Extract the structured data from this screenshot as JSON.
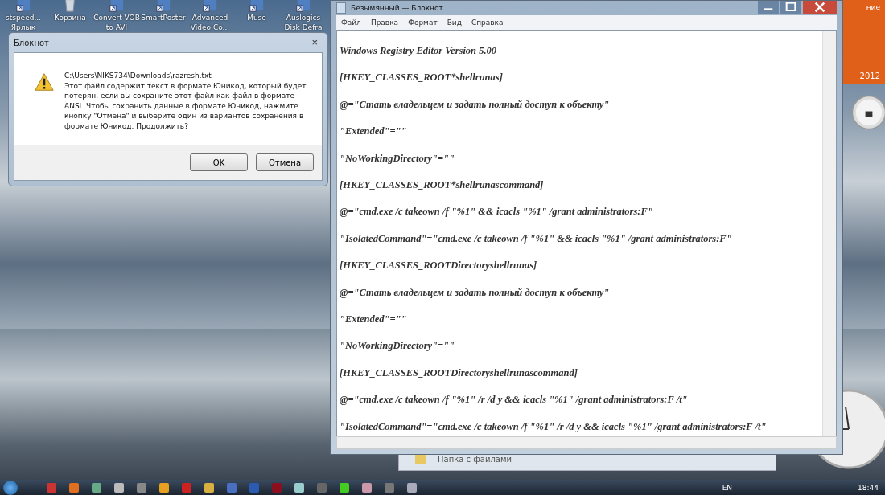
{
  "desktop_icons": [
    {
      "kind": "shortcut",
      "label": "stspeed...\nЯрлык"
    },
    {
      "kind": "trash",
      "label": "Корзина"
    },
    {
      "kind": "shortcut",
      "label": "Convert VOB\nto AVI"
    },
    {
      "kind": "shortcut",
      "label": "SmartPoster"
    },
    {
      "kind": "shortcut",
      "label": "Advanced\nVideo Co..."
    },
    {
      "kind": "shortcut",
      "label": "Muse"
    },
    {
      "kind": "shortcut",
      "label": "Auslogics\nDisk Defra"
    }
  ],
  "dialog": {
    "title": "Блокнот",
    "close": "×",
    "path": "C:\\Users\\NIKS734\\Downloads\\razresh.txt",
    "message": "Этот файл содержит текст в формате Юникод, который будет потерян, если вы сохраните этот файл как файл в формате ANSI. Чтобы сохранить данные в формате Юникод, нажмите кнопку \"Отмена\" и выберите один из вариантов сохранения в формате Юникод. Продолжить?",
    "buttons": [
      "OK",
      "Отмена"
    ]
  },
  "notepad": {
    "title": "Безымянный — Блокнот",
    "menu": [
      "Файл",
      "Правка",
      "Формат",
      "Вид",
      "Справка"
    ],
    "lines": [
      "Windows Registry Editor Version 5.00",
      "[HKEY_CLASSES_ROOT*shellrunas]",
      "@=\"Стать владельцем и задать полный доступ к объекту\"",
      "\"Extended\"=\"\"",
      "\"NoWorkingDirectory\"=\"\"",
      "[HKEY_CLASSES_ROOT*shellrunascommand]",
      "@=\"cmd.exe /c takeown /f \"%1\" && icacls \"%1\" /grant administrators:F\"",
      "\"IsolatedCommand\"=\"cmd.exe /c takeown /f \"%1\" && icacls \"%1\" /grant administrators:F\"",
      "[HKEY_CLASSES_ROOTDirectoryshellrunas]",
      "@=\"Стать владельцем и задать полный доступ к объекту\"",
      "\"Extended\"=\"\"",
      "\"NoWorkingDirectory\"=\"\"",
      "[HKEY_CLASSES_ROOTDirectoryshellrunascommand]",
      "@=\"cmd.exe /c takeown /f \"%1\" /r /d y && icacls \"%1\" /grant administrators:F /t\"",
      "\"IsolatedCommand\"=\"cmd.exe /c takeown /f \"%1\" /r /d y && icacls \"%1\" /grant administrators:F /t\""
    ]
  },
  "background_window": {
    "item": "Папка с файлами"
  },
  "calendar_gadget": {
    "header": "ние",
    "year": "2012"
  },
  "taskbar": {
    "language": "EN",
    "time": "18:44"
  }
}
